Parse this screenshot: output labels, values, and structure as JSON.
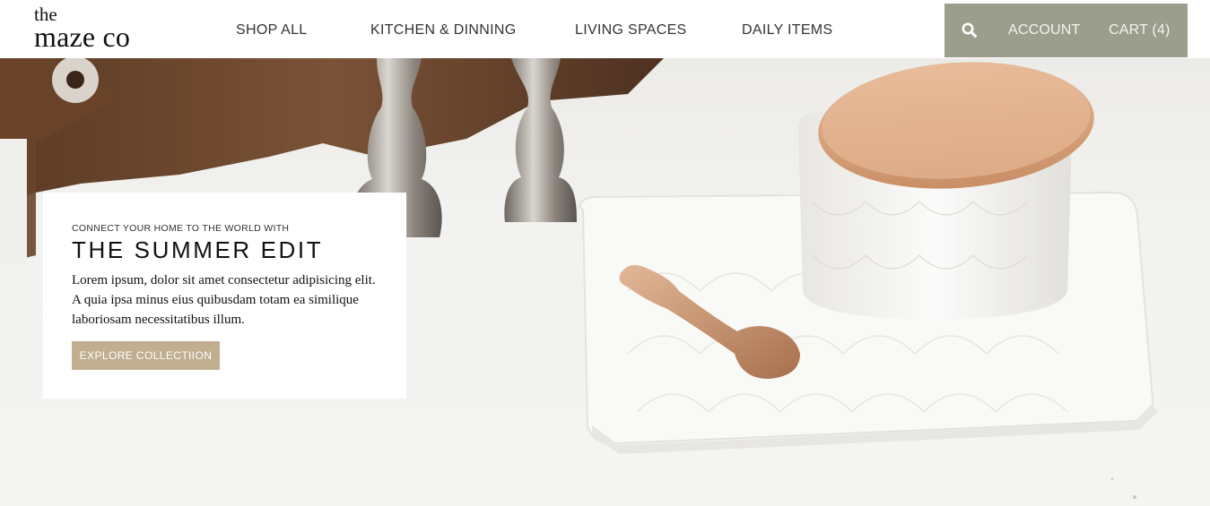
{
  "logo": {
    "line1": "the",
    "line2": "maze co"
  },
  "nav": {
    "items": [
      {
        "label": "SHOP ALL"
      },
      {
        "label": "KITCHEN & DINNING"
      },
      {
        "label": "LIVING SPACES"
      },
      {
        "label": "DAILY ITEMS"
      }
    ]
  },
  "utility": {
    "search_icon": "search-icon",
    "account_label": "ACCOUNT",
    "cart_label": "CART (4)"
  },
  "hero": {
    "eyebrow": "CONNECT YOUR HOME TO THE WORLD WITH",
    "title": "THE SUMMER EDIT",
    "body": "Lorem ipsum, dolor sit amet consectetur adipisicing elit. A quia ipsa minus eius quibusdam totam ea similique laboriosam necessitatibus illum.",
    "cta_label": "EXPLORE COLLECTIION"
  },
  "colors": {
    "utility_bg": "#9b9d8d",
    "cta_bg": "#c1ae90",
    "header_bg": "#ffffff"
  }
}
